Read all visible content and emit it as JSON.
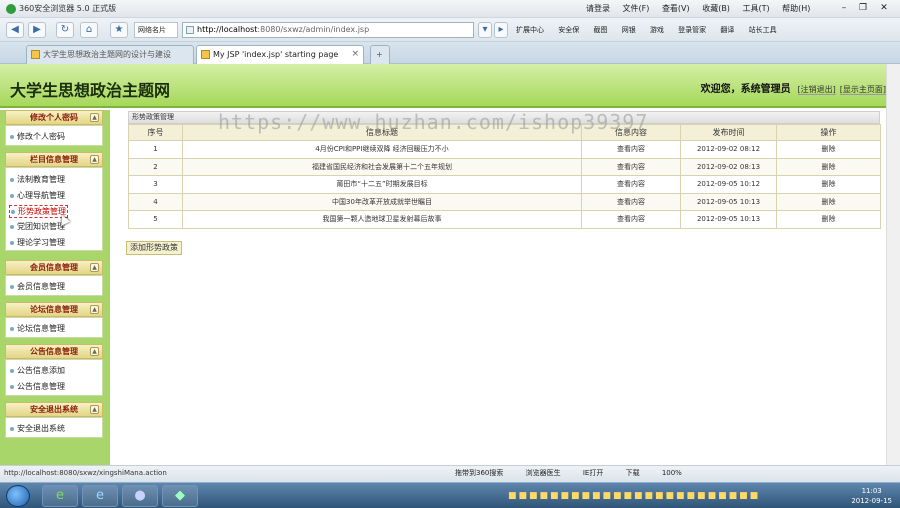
{
  "browser": {
    "title": "360安全浏览器 5.0 正式版",
    "login": "请登录",
    "menus": [
      "文件(F)",
      "查看(V)",
      "收藏(B)",
      "工具(T)",
      "帮助(H)"
    ],
    "fav_select": "网络名片",
    "address": "http://localhost:8080/sxwz/admin/index.jsp",
    "address_host": "http://localhost",
    "address_rest": ":8080/sxwz/admin/index.jsp",
    "toolbar": [
      "扩展中心",
      "安全保",
      "截图",
      "网银",
      "游戏",
      "登录管家",
      "翻译",
      "站长工具"
    ],
    "tabs": [
      {
        "label": "大学生思想政治主题网的设计与建设"
      },
      {
        "label": "My JSP 'index.jsp' starting page"
      }
    ],
    "status_url": "http://localhost:8080/sxwz/xingshiMana.action",
    "status_items": [
      "拖带到360搜索",
      "浏览器医生",
      "IE打开",
      "下载",
      "100%"
    ]
  },
  "site": {
    "title": "大学生思想政治主题网",
    "welcome": "欢迎您，",
    "user": "系统管理员",
    "logout": "[注销退出]",
    "home": "[显示主页面]"
  },
  "sidebar": {
    "groups": [
      {
        "title": "修改个人密码",
        "items": [
          "修改个人密码"
        ]
      },
      {
        "title": "栏目信息管理",
        "items": [
          "法制教育管理",
          "心理导航管理",
          "形势政策管理",
          "党团知识管理",
          "理论学习管理"
        ]
      },
      {
        "title": "会员信息管理",
        "items": [
          "会员信息管理"
        ]
      },
      {
        "title": "论坛信息管理",
        "items": [
          "论坛信息管理"
        ]
      },
      {
        "title": "公告信息管理",
        "items": [
          "公告信息添加",
          "公告信息管理"
        ]
      },
      {
        "title": "安全退出系统",
        "items": [
          "安全退出系统"
        ]
      }
    ]
  },
  "main": {
    "panel_title": "形势政策管理",
    "columns": [
      "序号",
      "信息标题",
      "信息内容",
      "发布时间",
      "操作"
    ],
    "rows": [
      {
        "no": "1",
        "title": "4月份CPI和PPI继续双降 经济回暖压力不小",
        "content": "查看内容",
        "time": "2012-09-02 08:12",
        "op": "删除"
      },
      {
        "no": "2",
        "title": "福建省国民经济和社会发展第十二个五年规划",
        "content": "查看内容",
        "time": "2012-09-02 08:13",
        "op": "删除"
      },
      {
        "no": "3",
        "title": "莆田市“十二五”时期发展目标",
        "content": "查看内容",
        "time": "2012-09-05 10:12",
        "op": "删除"
      },
      {
        "no": "4",
        "title": "中国30年改革开放成就举世瞩目",
        "content": "查看内容",
        "time": "2012-09-05 10:13",
        "op": "删除"
      },
      {
        "no": "5",
        "title": "我国第一颗人造地球卫星发射幕后故事",
        "content": "查看内容",
        "time": "2012-09-05 10:13",
        "op": "删除"
      }
    ],
    "add_button": "添加形势政策"
  },
  "watermark": "https://www.huzhan.com/ishop39397",
  "clock": {
    "time": "11:03",
    "date": "2012-09-15"
  }
}
